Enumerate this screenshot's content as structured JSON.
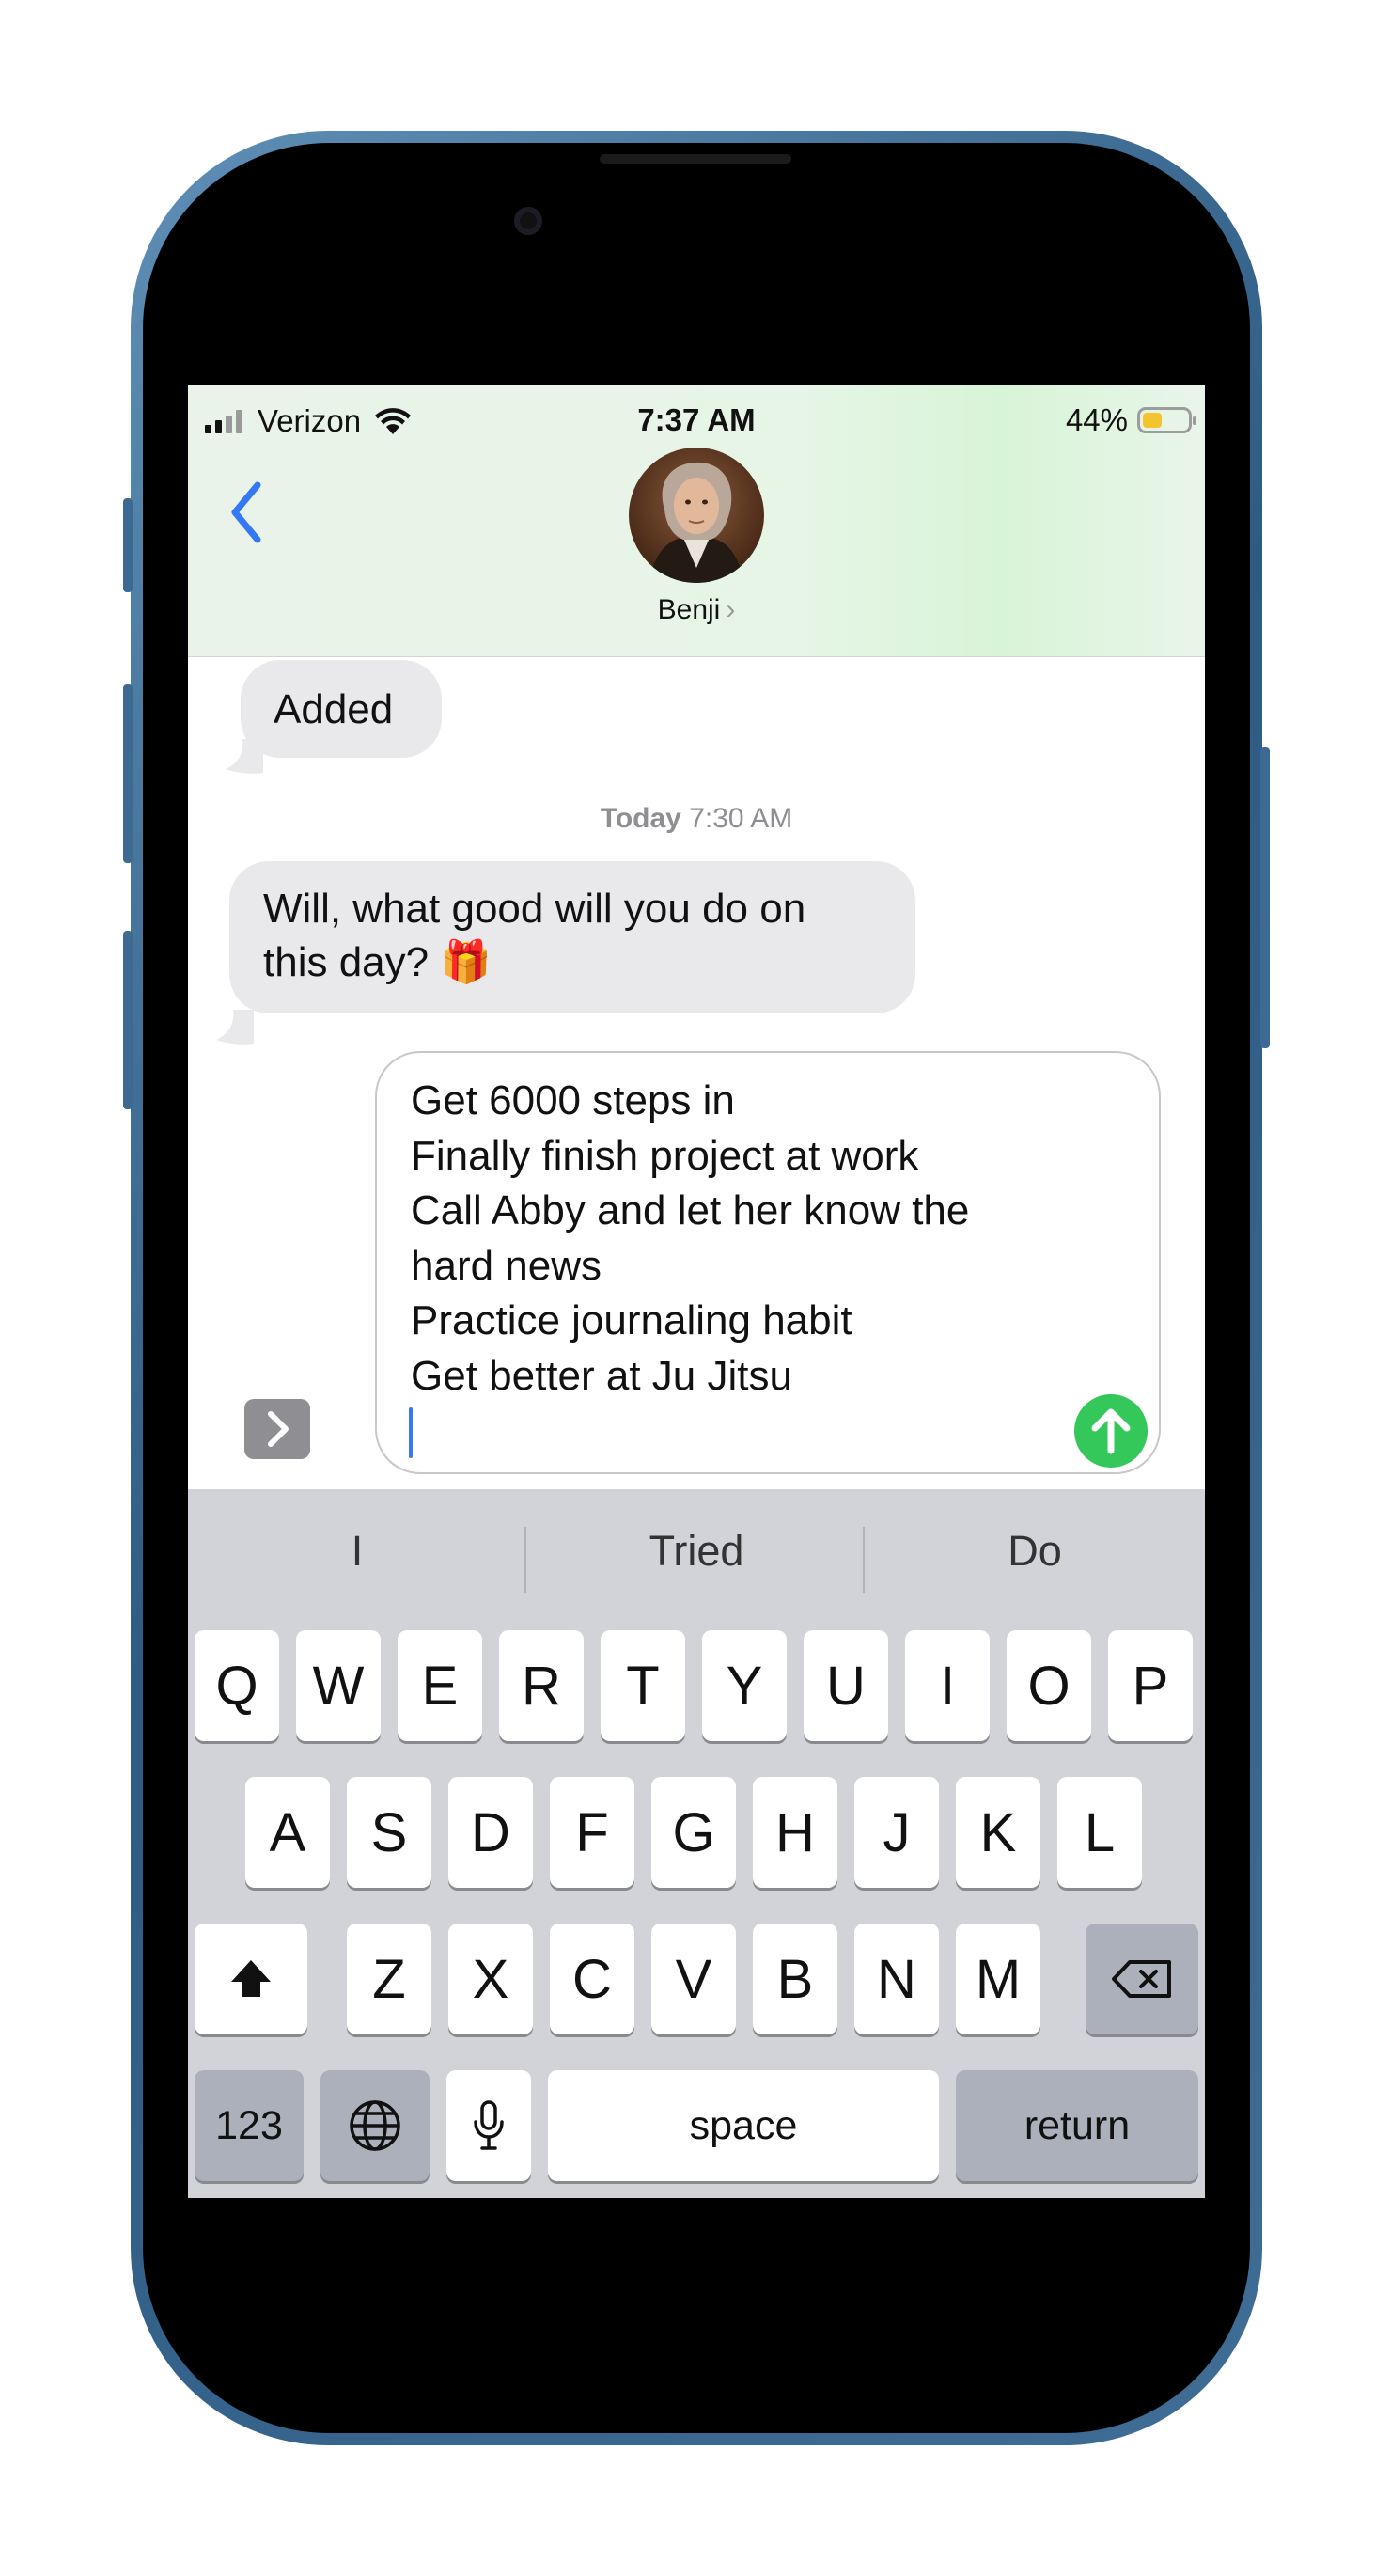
{
  "status_bar": {
    "carrier": "Verizon",
    "time": "7:37 AM",
    "battery_percent": "44%",
    "battery_level": 0.44,
    "icons": [
      "signal-icon",
      "wifi-icon",
      "battery-icon"
    ]
  },
  "nav": {
    "back_icon": "chevron-left-icon",
    "contact_name": "Benji",
    "contact_chevron": "›",
    "avatar": "contact-avatar-portrait"
  },
  "messages": {
    "received_1": "Added",
    "timestamp_day": "Today",
    "timestamp_time": "7:30 AM",
    "received_2_line1": "Will, what good will you do on",
    "received_2_line2": "this day? 🎁"
  },
  "compose": {
    "lines": [
      "Get 6000 steps in",
      "Finally finish project at work",
      "Call Abby and let her know the",
      "hard news",
      "Practice journaling habit",
      "Get better at Ju Jitsu"
    ],
    "send_icon": "arrow-up-icon",
    "apps_icon": "chevron-right-icon"
  },
  "keyboard": {
    "suggestions": [
      "I",
      "Tried",
      "Do"
    ],
    "row1": [
      "Q",
      "W",
      "E",
      "R",
      "T",
      "Y",
      "U",
      "I",
      "O",
      "P"
    ],
    "row2": [
      "A",
      "S",
      "D",
      "F",
      "G",
      "H",
      "J",
      "K",
      "L"
    ],
    "row3": [
      "Z",
      "X",
      "C",
      "V",
      "B",
      "N",
      "M"
    ],
    "numbers_label": "123",
    "space_label": "space",
    "return_label": "return",
    "shift_icon": "shift-icon",
    "delete_icon": "delete-icon",
    "globe_icon": "globe-icon",
    "mic_icon": "microphone-icon"
  },
  "colors": {
    "accent_blue": "#3478f6",
    "send_green": "#34c759",
    "received_bubble": "#e9e9eb",
    "keyboard_bg": "#d1d3d9",
    "frame_blue": "#3d6a92"
  }
}
